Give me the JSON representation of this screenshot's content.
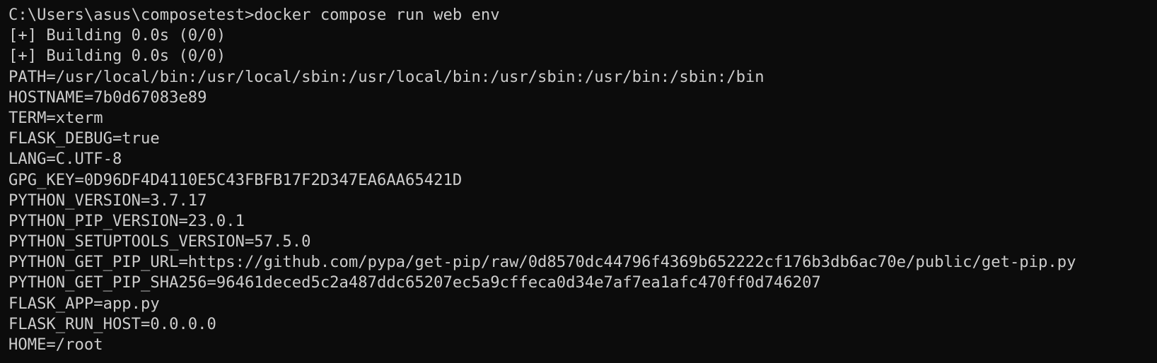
{
  "terminal": {
    "lines": [
      "C:\\Users\\asus\\composetest>docker compose run web env",
      "[+] Building 0.0s (0/0)",
      "[+] Building 0.0s (0/0)",
      "PATH=/usr/local/bin:/usr/local/sbin:/usr/local/bin:/usr/sbin:/usr/bin:/sbin:/bin",
      "HOSTNAME=7b0d67083e89",
      "TERM=xterm",
      "FLASK_DEBUG=true",
      "LANG=C.UTF-8",
      "GPG_KEY=0D96DF4D4110E5C43FBFB17F2D347EA6AA65421D",
      "PYTHON_VERSION=3.7.17",
      "PYTHON_PIP_VERSION=23.0.1",
      "PYTHON_SETUPTOOLS_VERSION=57.5.0",
      "PYTHON_GET_PIP_URL=https://github.com/pypa/get-pip/raw/0d8570dc44796f4369b652222cf176b3db6ac70e/public/get-pip.py",
      "PYTHON_GET_PIP_SHA256=96461deced5c2a487ddc65207ec5a9cffeca0d34e7af7ea1afc470ff0d746207",
      "FLASK_APP=app.py",
      "FLASK_RUN_HOST=0.0.0.0",
      "HOME=/root"
    ],
    "colors": {
      "background": "#0c0c0c",
      "foreground": "#cccccc"
    }
  }
}
